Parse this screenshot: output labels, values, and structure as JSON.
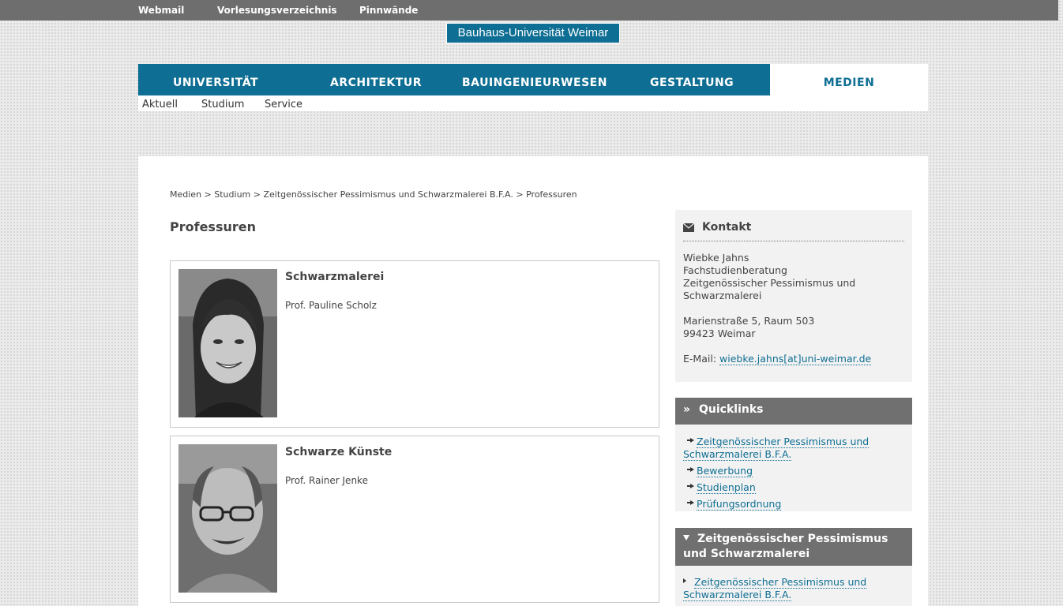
{
  "topbar": {
    "links": [
      "Webmail",
      "Vorlesungsverzeichnis",
      "Pinnwände"
    ]
  },
  "logo": "Bauhaus-Universität Weimar",
  "nav": {
    "items": [
      "UNIVERSITÄT",
      "ARCHITEKTUR",
      "BAUINGENIEURWESEN",
      "GESTALTUNG"
    ],
    "active": "MEDIEN",
    "sub": [
      "Aktuell",
      "Studium",
      "Service"
    ]
  },
  "breadcrumb": [
    "Medien",
    ">",
    "Studium",
    ">",
    "Zeitgenössischer Pessimismus und Schwarzmalerei B.F.A.",
    ">",
    "Professuren"
  ],
  "page": {
    "title": "Professuren"
  },
  "professors": [
    {
      "title": "Schwarzmalerei",
      "name": "Prof. Pauline Scholz"
    },
    {
      "title": "Schwarze Künste",
      "name": "Prof. Rainer Jenke"
    }
  ],
  "contact": {
    "heading": "Kontakt",
    "lines": [
      "Wiebke Jahns",
      "Fachstudienberatung",
      "Zeitgenössischer Pessimismus und",
      "Schwarzmalerei"
    ],
    "address": [
      "Marienstraße 5, Raum 503",
      "99423 Weimar"
    ],
    "email_label": "E-Mail:",
    "email": "wiebke.jahns[at]uni-weimar.de"
  },
  "quicklinks": {
    "heading": "Quicklinks",
    "items": [
      [
        "Zeitgenössischer Pessimismus und",
        "Schwarzmalerei B.F.A."
      ],
      [
        "Bewerbung"
      ],
      [
        "Studienplan"
      ],
      [
        "Prüfungsordnung"
      ]
    ]
  },
  "program": {
    "heading": [
      "Zeitgenössischer Pessimismus",
      "und Schwarzmalerei"
    ],
    "items": [
      [
        "Zeitgenössischer Pessimismus und",
        "Schwarzmalerei B.F.A."
      ]
    ]
  },
  "colors": {
    "accent": "#0e6e93",
    "panel_header": "#707070",
    "panel_bg": "#f2f2f2",
    "topbar": "#6e6e6e"
  }
}
